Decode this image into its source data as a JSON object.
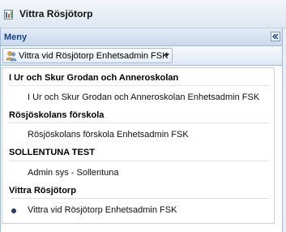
{
  "window": {
    "title": "Vittra Rösjötorp",
    "icon": "app-icon"
  },
  "panel": {
    "header": "Meny",
    "collapse_icon": "double-chevron-left-icon"
  },
  "toolbar": {
    "button_label": "Vittra vid Rösjötorp Enhetsadmin FSK",
    "button_icon": "users-icon",
    "arrow_icon": "chevron-down-icon"
  },
  "menu": {
    "groups": [
      {
        "label": "I Ur och Skur Grodan och Anneroskolan",
        "items": [
          {
            "label": "I Ur och Skur Grodan och Anneroskolan Enhetsadmin FSK",
            "selected": false
          }
        ]
      },
      {
        "label": "Rösjöskolans förskola",
        "items": [
          {
            "label": "Rösjöskolans förskola Enhetsadmin FSK",
            "selected": false
          }
        ]
      },
      {
        "label": "SOLLENTUNA TEST",
        "items": [
          {
            "label": "Admin sys - Sollentuna",
            "selected": false
          }
        ]
      },
      {
        "label": "Vittra Rösjötorp",
        "items": [
          {
            "label": "Vittra vid Rösjötorp Enhetsadmin FSK",
            "selected": true
          }
        ]
      }
    ]
  },
  "colors": {
    "header_text": "#15428b",
    "border": "#99bbe8",
    "selected_dot": "#1f3a6e"
  }
}
